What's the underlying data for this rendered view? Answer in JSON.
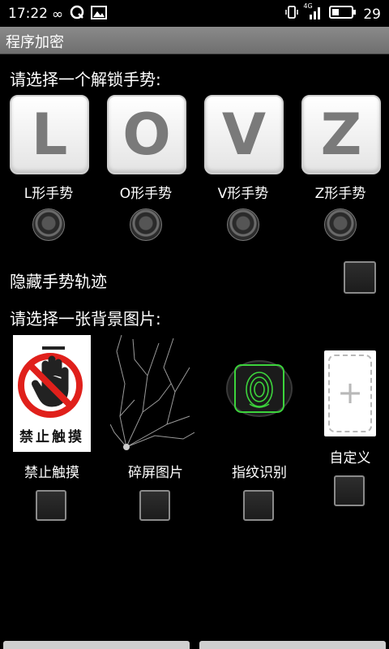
{
  "status": {
    "time": "17:22",
    "battery": "29",
    "network": "4G"
  },
  "app": {
    "title": "程序加密"
  },
  "gesture_section": {
    "heading": "请选择一个解锁手势:",
    "items": [
      {
        "letter": "L",
        "label": "L形手势"
      },
      {
        "letter": "O",
        "label": "O形手势"
      },
      {
        "letter": "V",
        "label": "V形手势"
      },
      {
        "letter": "Z",
        "label": "Z形手势"
      }
    ]
  },
  "hide_trace": {
    "label": "隐藏手势轨迹"
  },
  "background_section": {
    "heading": "请选择一张背景图片:",
    "items": [
      {
        "label": "禁止触摸",
        "image_text": "禁止触摸"
      },
      {
        "label": "碎屏图片"
      },
      {
        "label": "指纹识别"
      },
      {
        "label": "自定义"
      }
    ]
  },
  "colors": {
    "accent_red": "#e0201b",
    "fingerprint_green": "#3cd43c",
    "panel_gray": "#7b7b7b"
  }
}
